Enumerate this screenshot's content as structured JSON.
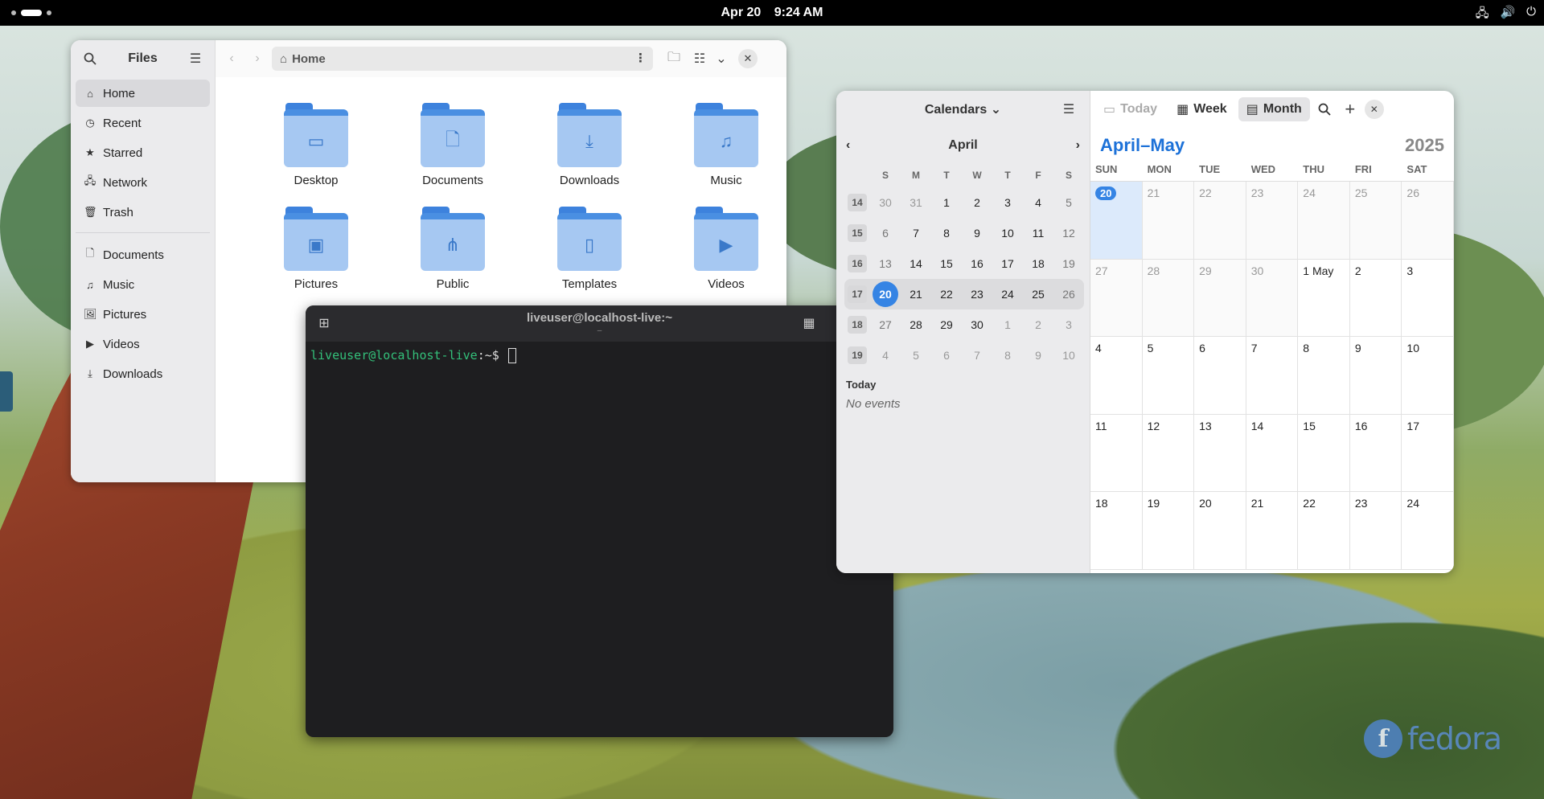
{
  "topbar": {
    "date": "Apr 20",
    "time": "9:24 AM",
    "tray_icons": [
      "network-icon",
      "volume-icon",
      "power-icon"
    ]
  },
  "wallpaper": {
    "brand": "fedora"
  },
  "files": {
    "title": "Files",
    "path": "Home",
    "sidebar": [
      {
        "label": "Home",
        "icon": "home-icon",
        "active": true
      },
      {
        "label": "Recent",
        "icon": "clock-icon"
      },
      {
        "label": "Starred",
        "icon": "star-icon"
      },
      {
        "label": "Network",
        "icon": "network-icon"
      },
      {
        "label": "Trash",
        "icon": "trash-icon"
      }
    ],
    "bookmarks": [
      {
        "label": "Documents",
        "icon": "document-icon"
      },
      {
        "label": "Music",
        "icon": "music-icon"
      },
      {
        "label": "Pictures",
        "icon": "picture-icon"
      },
      {
        "label": "Videos",
        "icon": "video-icon"
      },
      {
        "label": "Downloads",
        "icon": "download-icon"
      }
    ],
    "folders": [
      {
        "label": "Desktop",
        "icon": "desktop-folder-icon"
      },
      {
        "label": "Documents",
        "icon": "documents-folder-icon"
      },
      {
        "label": "Downloads",
        "icon": "downloads-folder-icon"
      },
      {
        "label": "Music",
        "icon": "music-folder-icon"
      },
      {
        "label": "Pictures",
        "icon": "pictures-folder-icon"
      },
      {
        "label": "Public",
        "icon": "public-folder-icon"
      },
      {
        "label": "Templates",
        "icon": "templates-folder-icon"
      },
      {
        "label": "Videos",
        "icon": "videos-folder-icon"
      }
    ]
  },
  "terminal": {
    "title": "liveuser@localhost-live:~",
    "subtitle": "–",
    "prompt_user": "liveuser@localhost-live",
    "prompt_path": ":~$ "
  },
  "calendar": {
    "calendars_label": "Calendars",
    "mini_month": "April",
    "mini_dow": [
      "S",
      "M",
      "T",
      "W",
      "T",
      "F",
      "S"
    ],
    "mini_weeks": [
      {
        "week": "14",
        "days": [
          "30",
          "31",
          "1",
          "2",
          "3",
          "4",
          "5"
        ],
        "dim": [
          0,
          1
        ]
      },
      {
        "week": "15",
        "days": [
          "6",
          "7",
          "8",
          "9",
          "10",
          "11",
          "12"
        ],
        "dim": []
      },
      {
        "week": "16",
        "days": [
          "13",
          "14",
          "15",
          "16",
          "17",
          "18",
          "19"
        ],
        "dim": []
      },
      {
        "week": "17",
        "days": [
          "20",
          "21",
          "22",
          "23",
          "24",
          "25",
          "26"
        ],
        "dim": [],
        "selected": true,
        "today_index": 0
      },
      {
        "week": "18",
        "days": [
          "27",
          "28",
          "29",
          "30",
          "1",
          "2",
          "3"
        ],
        "dim": [
          4,
          5,
          6
        ]
      },
      {
        "week": "19",
        "days": [
          "4",
          "5",
          "6",
          "7",
          "8",
          "9",
          "10"
        ],
        "dim": [
          0,
          1,
          2,
          3,
          4,
          5,
          6
        ]
      }
    ],
    "today_label": "Today",
    "no_events": "No events",
    "views": {
      "today": "Today",
      "week": "Week",
      "month": "Month"
    },
    "heading": "April–May",
    "year": "2025",
    "dow": [
      "SUN",
      "MON",
      "TUE",
      "WED",
      "THU",
      "FRI",
      "SAT"
    ],
    "month_weeks": [
      [
        "20",
        "21",
        "22",
        "23",
        "24",
        "25",
        "26"
      ],
      [
        "27",
        "28",
        "29",
        "30",
        "1 May",
        "2",
        "3"
      ],
      [
        "4",
        "5",
        "6",
        "7",
        "8",
        "9",
        "10"
      ],
      [
        "11",
        "12",
        "13",
        "14",
        "15",
        "16",
        "17"
      ],
      [
        "18",
        "19",
        "20",
        "21",
        "22",
        "23",
        "24"
      ]
    ],
    "month_dim_cells": [
      1,
      2,
      3,
      4,
      5,
      6,
      7,
      8,
      9,
      10
    ],
    "today_cell": 0
  }
}
